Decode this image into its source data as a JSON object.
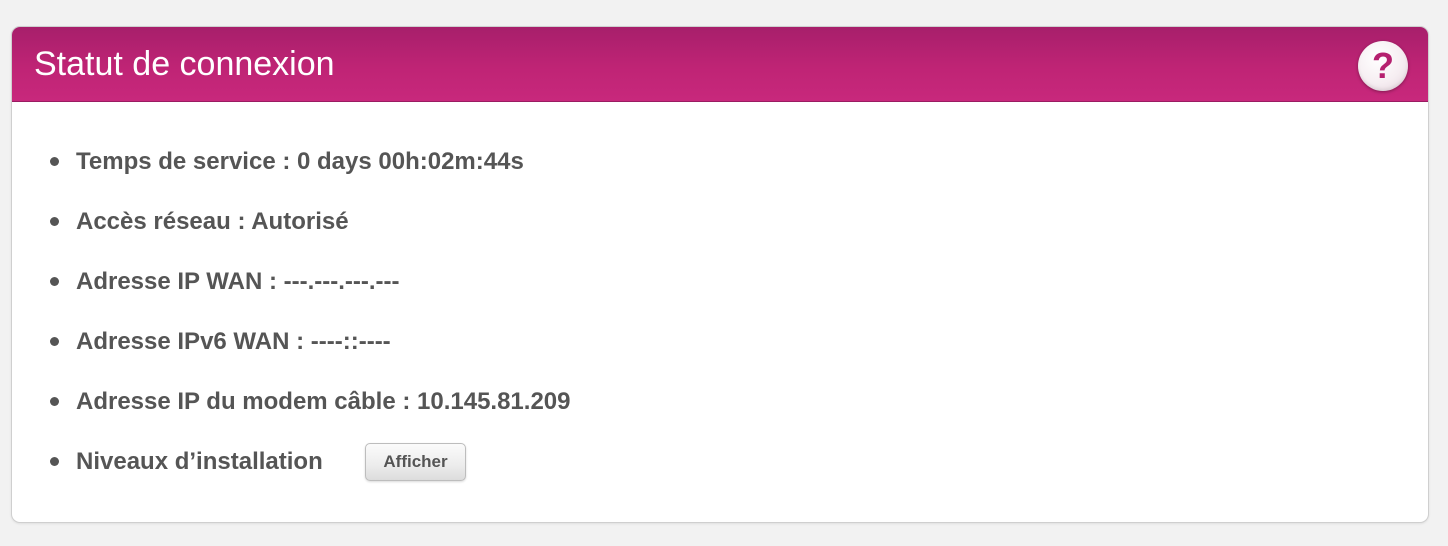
{
  "panel": {
    "title": "Statut de connexion",
    "help_icon_glyph": "?"
  },
  "status": {
    "uptime": "Temps de service : 0 days 00h:02m:44s",
    "network_access": "Accès réseau : Autorisé",
    "wan_ip": "Adresse IP WAN : ---.---.---.---",
    "wan_ipv6": "Adresse IPv6 WAN : ----::----",
    "cable_modem_ip": "Adresse IP du modem câble : 10.145.81.209",
    "install_levels_label": "Niveaux d’installation",
    "install_levels_button": "Afficher"
  },
  "icons": {
    "help": "help-icon",
    "bullet": "bullet-icon"
  },
  "colors": {
    "header_magenta": "#c0267a",
    "text_gray": "#555555",
    "background": "#f2f2f2"
  }
}
